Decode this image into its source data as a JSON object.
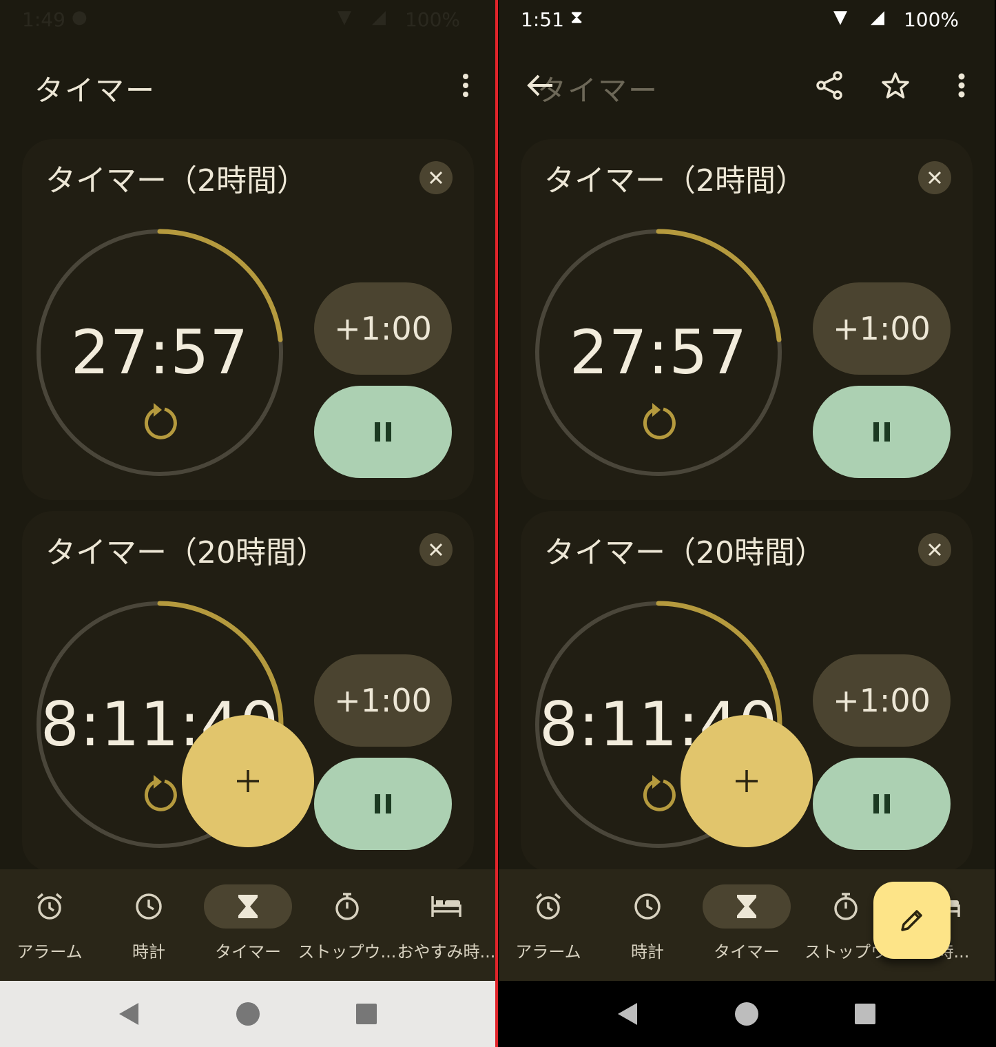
{
  "colors": {
    "background": "#1c1a10",
    "card": "#211e13",
    "accent_ring": "#b59a3e",
    "ring_track": "#4a463a",
    "add_button": "#4b4430",
    "pause_button": "#acd0b2",
    "fab": "#e1c56c",
    "edit_fab": "#fde488",
    "divider": "#e0242a"
  },
  "left": {
    "status": {
      "time": "1:49",
      "battery": "100%"
    },
    "app_title": "タイマー",
    "timers": [
      {
        "label": "タイマー（2時間）",
        "remaining": "27:57",
        "add_label": "+1:00",
        "progress_remaining": 0.233,
        "ring_icon": "reset-icon"
      },
      {
        "label": "タイマー（20時間）",
        "remaining": "8:11:40",
        "add_label": "+1:00",
        "progress_remaining": 0.41,
        "ring_icon": "reset-icon"
      }
    ],
    "nav": [
      {
        "label": "アラーム",
        "icon": "alarm-icon"
      },
      {
        "label": "時計",
        "icon": "clock-icon"
      },
      {
        "label": "タイマー",
        "icon": "hourglass-icon",
        "active": true
      },
      {
        "label": "ストップウ...",
        "icon": "stopwatch-icon"
      },
      {
        "label": "おやすみ時...",
        "icon": "bed-icon"
      }
    ]
  },
  "right": {
    "status": {
      "time": "1:51",
      "battery": "100%"
    },
    "app_title": "タイマー",
    "timers": [
      {
        "label": "タイマー（2時間）",
        "remaining": "27:57",
        "add_label": "+1:00",
        "progress_remaining": 0.233
      },
      {
        "label": "タイマー（20時間）",
        "remaining": "8:11:40",
        "add_label": "+1:00",
        "progress_remaining": 0.41
      }
    ],
    "nav": [
      {
        "label": "アラーム",
        "icon": "alarm-icon"
      },
      {
        "label": "時計",
        "icon": "clock-icon"
      },
      {
        "label": "タイマー",
        "icon": "hourglass-icon",
        "active": true
      },
      {
        "label": "ストップウ",
        "icon": "stopwatch-icon"
      },
      {
        "label": "み時...",
        "icon": "bed-icon"
      }
    ]
  }
}
